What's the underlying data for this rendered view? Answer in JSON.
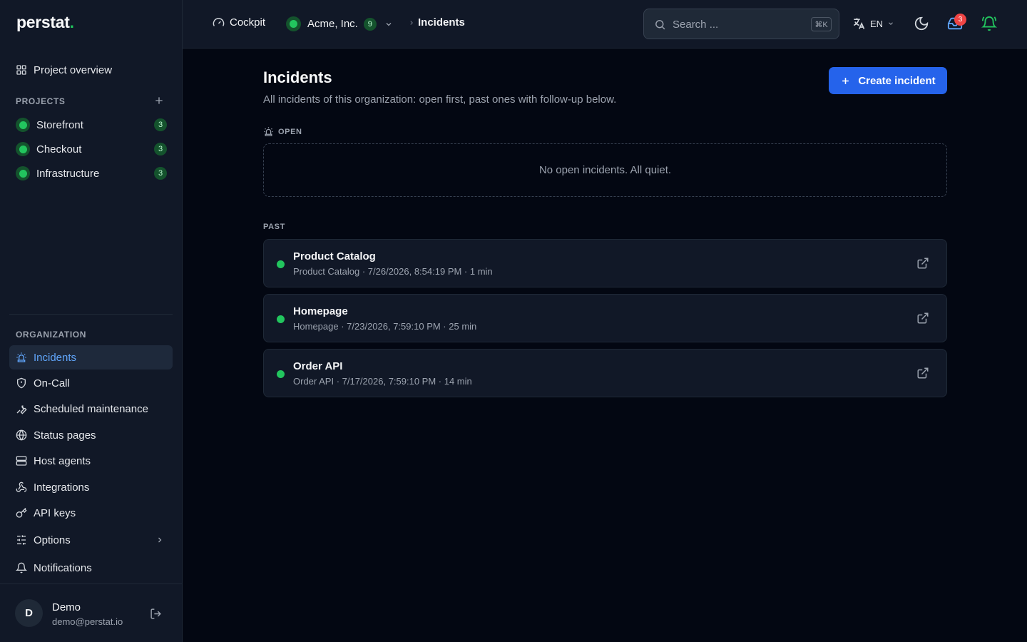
{
  "app": {
    "logo_text": "perstat",
    "logo_dot": "."
  },
  "sidebar": {
    "project_overview": "Project overview",
    "projects_label": "PROJECTS",
    "projects": [
      {
        "name": "Storefront",
        "count": "3"
      },
      {
        "name": "Checkout",
        "count": "3"
      },
      {
        "name": "Infrastructure",
        "count": "3"
      }
    ],
    "organization_label": "ORGANIZATION",
    "items": [
      {
        "label": "Incidents",
        "icon": "siren-icon",
        "active": true
      },
      {
        "label": "On-Call",
        "icon": "shield-icon"
      },
      {
        "label": "Scheduled maintenance",
        "icon": "wrench-icon"
      },
      {
        "label": "Status pages",
        "icon": "globe-icon"
      },
      {
        "label": "Host agents",
        "icon": "server-icon"
      },
      {
        "label": "Integrations",
        "icon": "webhook-icon"
      },
      {
        "label": "API keys",
        "icon": "key-icon"
      },
      {
        "label": "Options",
        "icon": "sliders-icon"
      },
      {
        "label": "Notifications",
        "icon": "bell-icon"
      }
    ],
    "user": {
      "initial": "D",
      "name": "Demo",
      "email": "demo@perstat.io"
    }
  },
  "topbar": {
    "cockpit": "Cockpit",
    "org_name": "Acme, Inc.",
    "org_count": "9",
    "current": "Incidents",
    "search_placeholder": "Search ...",
    "search_shortcut": "⌘K",
    "language": "EN",
    "inbox_badge": "3"
  },
  "main": {
    "title": "Incidents",
    "subtitle": "All incidents of this organization: open first, past ones with follow-up below.",
    "create_button": "Create incident",
    "open_label": "OPEN",
    "open_empty": "No open incidents. All quiet.",
    "past_label": "PAST",
    "past": [
      {
        "title": "Product Catalog",
        "meta": "Product Catalog · 7/26/2026, 8:54:19 PM · 1 min"
      },
      {
        "title": "Homepage",
        "meta": "Homepage · 7/23/2026, 7:59:10 PM · 25 min"
      },
      {
        "title": "Order API",
        "meta": "Order API · 7/17/2026, 7:59:10 PM · 14 min"
      }
    ]
  },
  "colors": {
    "accent": "#2563eb",
    "success": "#22c55e",
    "danger": "#ef4444",
    "background": "#030712",
    "surface": "#111827"
  }
}
